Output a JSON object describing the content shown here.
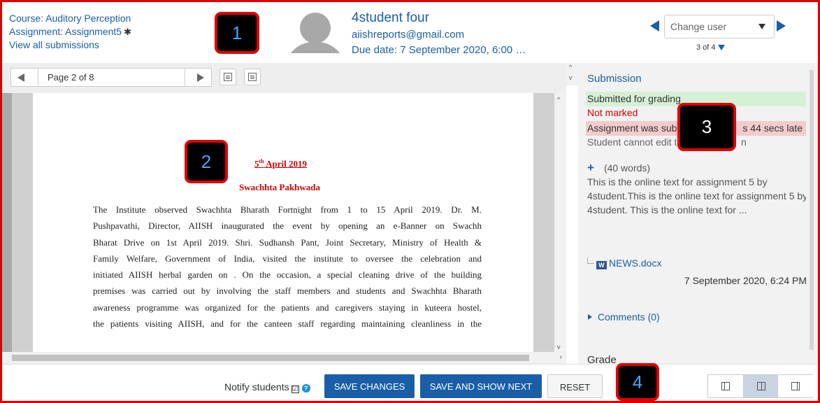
{
  "header": {
    "course": "Course: Auditory Perception",
    "assignment": "Assignment: Assignment5",
    "view_all": "View all submissions",
    "student_name": "4student four",
    "student_email": "aiishreports@gmail.com",
    "due_date": "Due date: 7 September 2020, 6:00 …",
    "change_user_placeholder": "Change user",
    "user_count": "3 of 4"
  },
  "pdf": {
    "page_label": "Page 2 of 8",
    "date_day": "5",
    "date_sup": "th",
    "date_rest": " April 2019",
    "heading": "Swachhta Pakhwada",
    "body_lines": [
      "The Institute observed Swachhta Bharath Fortnight from 1 to 15 April 2019. Dr. M.",
      "Pushpavathi, Director, AIISH inaugurated the event by opening an e-Banner on Swachh",
      "Bharat Drive on 1st April 2019. Shri. Sudhansh Pant, Joint Secretary, Ministry of Health &",
      "Family Welfare, Government of India, visited the institute to oversee the celebration and",
      "initiated AIISH herbal garden on . On the occasion, a special cleaning drive of the building",
      "premises was carried out by involving the staff members and students and Swachhta Bharath",
      "awareness programme was organized for the patients and caregivers staying in kuteera hostel,",
      "the patients visiting AIISH, and for the canteen staff regarding maintaining cleanliness in the"
    ]
  },
  "grading": {
    "section_title": "Submission",
    "status_submitted": "Submitted for grading",
    "status_not_marked": "Not marked",
    "status_late_head": "Assignment was sub",
    "status_late_tail": "s 44 secs late",
    "status_edit": "Student cannot edit t",
    "status_edit_tail": "n",
    "word_count": "(40 words)",
    "online_text": "This is the online text for assignment 5 by 4student.This is the online text for assignment 5 by 4student. This is the online text for ...",
    "file_icon_text": "W",
    "file_name": "NEWS.docx",
    "file_date": "7 September 2020, 6:24 PM",
    "comments": "Comments (0)",
    "grade_label": "Grade"
  },
  "footer": {
    "notify_label": "Notify students",
    "checkbox_mark": "☑",
    "help_glyph": "?",
    "save_changes": "SAVE CHANGES",
    "save_and_next": "SAVE AND SHOW NEXT",
    "reset": "RESET"
  },
  "markers": [
    "1",
    "2",
    "3",
    "4"
  ],
  "colors": {
    "link_blue": "#1a5ea8",
    "annotation_red": "#e00000",
    "submitted_green": "#d6f0d6",
    "late_red": "#f2cccc",
    "not_marked_text": "#d40000"
  },
  "icons": [
    "gear-icon",
    "avatar-icon",
    "arrow-left-icon",
    "arrow-right-icon",
    "filter-icon",
    "word-doc-icon",
    "plus-icon",
    "help-icon"
  ]
}
